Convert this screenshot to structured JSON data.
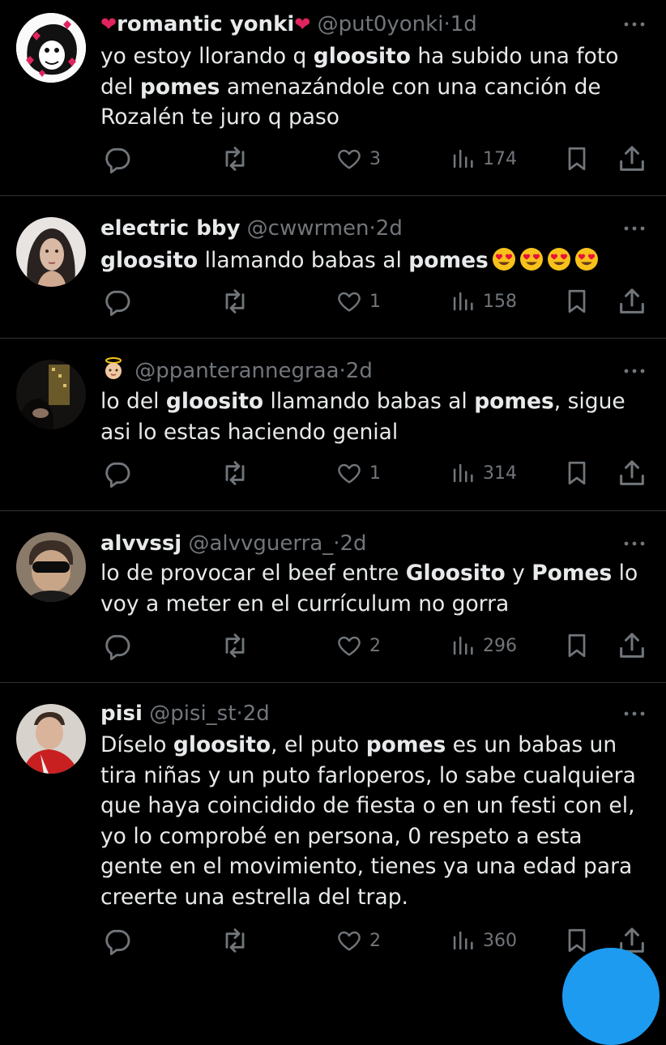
{
  "tweets": [
    {
      "name": "romantic yonki",
      "handle": "@put0yonki",
      "dot": "·",
      "time": "1d",
      "lines": [
        [
          {
            "t": "yo estoy llorando q "
          },
          {
            "t": "gloosito",
            "b": true
          },
          {
            "t": " ha subido una foto"
          }
        ],
        [
          {
            "t": "del "
          },
          {
            "t": "pomes",
            "b": true
          },
          {
            "t": " amenazándole con una canción de"
          }
        ],
        [
          {
            "t": "Rozalén te juro q paso"
          }
        ]
      ],
      "likes": "3",
      "views": "174"
    },
    {
      "name": "electric bby",
      "handle": "@cwwrmen",
      "dot": "·",
      "time": "2d",
      "lines": [
        [
          {
            "t": "gloosito",
            "b": true
          },
          {
            "t": " llamando babas al "
          },
          {
            "t": "pomes",
            "b": true
          }
        ]
      ],
      "emoji_count": 4,
      "likes": "1",
      "views": "158"
    },
    {
      "name": "",
      "handle": "@ppanterannegraa",
      "dot": "·",
      "time": "2d",
      "lines": [
        [
          {
            "t": "lo del "
          },
          {
            "t": "gloosito",
            "b": true
          },
          {
            "t": "  llamando babas al "
          },
          {
            "t": "pomes",
            "b": true
          },
          {
            "t": ", sigue"
          }
        ],
        [
          {
            "t": "asi  lo estas  haciendo genial"
          }
        ]
      ],
      "likes": "1",
      "views": "314"
    },
    {
      "name": "alvvssj",
      "handle": "@alvvguerra_",
      "dot": "·",
      "time": "2d",
      "lines": [
        [
          {
            "t": "lo de provocar el beef entre "
          },
          {
            "t": "Gloosito",
            "b": true
          },
          {
            "t": " y "
          },
          {
            "t": "Pomes",
            "b": true
          },
          {
            "t": " lo"
          }
        ],
        [
          {
            "t": "voy a meter en el currículum no gorra"
          }
        ]
      ],
      "likes": "2",
      "views": "296"
    },
    {
      "name": "pisi",
      "handle": "@pisi_st",
      "dot": "·",
      "time": "2d",
      "lines": [
        [
          {
            "t": "Díselo "
          },
          {
            "t": "gloosito",
            "b": true
          },
          {
            "t": ", el puto "
          },
          {
            "t": "pomes",
            "b": true
          },
          {
            "t": " es un babas un"
          }
        ],
        [
          {
            "t": "tira niñas  y un puto farloperos, lo sabe cualquiera"
          }
        ],
        [
          {
            "t": "que haya coincidido de fiesta o en un festi con el,"
          }
        ],
        [
          {
            "t": "yo lo comprobé en persona, 0 respeto a esta"
          }
        ],
        [
          {
            "t": "gente en el movimiento, tienes ya una edad para"
          }
        ],
        [
          {
            "t": "creerte una estrella del trap."
          }
        ]
      ],
      "likes": "2",
      "views": "360"
    }
  ],
  "icons": {
    "reply": "reply-icon",
    "retweet": "retweet-icon",
    "like": "heart-icon",
    "views": "views-icon",
    "bookmark": "bookmark-icon",
    "share": "share-icon",
    "more": "more-icon"
  },
  "colors": {
    "background": "#000000",
    "text": "#e7e9ea",
    "muted": "#71767b",
    "divider": "#2f3336",
    "accent": "#1d9bf0",
    "heart": "#e0245e"
  }
}
